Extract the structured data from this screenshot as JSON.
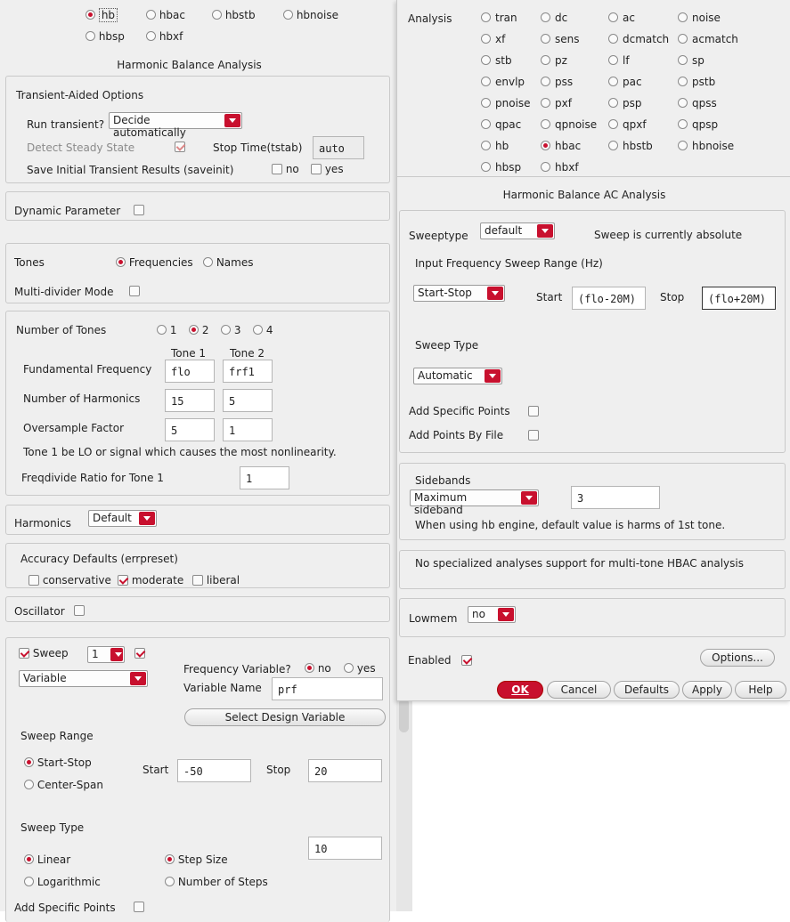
{
  "left": {
    "analysis_row1": [
      {
        "label": "hb",
        "selected": true
      },
      {
        "label": "hbac",
        "selected": false
      },
      {
        "label": "hbstb",
        "selected": false
      },
      {
        "label": "hbnoise",
        "selected": false
      }
    ],
    "analysis_row2": [
      {
        "label": "hbsp",
        "selected": false
      },
      {
        "label": "hbxf",
        "selected": false
      }
    ],
    "section_title": "Harmonic Balance Analysis",
    "transient": {
      "title": "Transient-Aided Options",
      "run_label": "Run transient?",
      "run_value": "Decide automatically",
      "detect_label": "Detect Steady State",
      "stop_label": "Stop Time(tstab)",
      "stop_value": "auto",
      "save_label": "Save Initial Transient Results (saveinit)",
      "no_label": "no",
      "yes_label": "yes"
    },
    "dynamic_label": "Dynamic Parameter",
    "tones_label": "Tones",
    "frequencies_label": "Frequencies",
    "names_label": "Names",
    "multidivider_label": "Multi-divider Mode",
    "num_tones_label": "Number of Tones",
    "num_tones_options": [
      "1",
      "2",
      "3",
      "4"
    ],
    "tone1_header": "Tone 1",
    "tone2_header": "Tone 2",
    "fund_label": "Fundamental Frequency",
    "fund_values": [
      "flo",
      "frf1"
    ],
    "harm_label": "Number of Harmonics",
    "harm_values": [
      "15",
      "5"
    ],
    "over_label": "Oversample Factor",
    "over_values": [
      "5",
      "1"
    ],
    "tone_note": "Tone 1 be LO or signal which causes the most nonlinearity.",
    "freqdivide_label": "Freqdivide Ratio for Tone 1",
    "freqdivide_value": "1",
    "harmonics_label": "Harmonics",
    "harmonics_value": "Default",
    "accuracy_label": "Accuracy Defaults (errpreset)",
    "conservative_label": "conservative",
    "moderate_label": "moderate",
    "liberal_label": "liberal",
    "oscillator_label": "Oscillator",
    "sweep": {
      "label": "Sweep",
      "count": "1",
      "variable_value": "Variable",
      "freq_var_label": "Frequency Variable?",
      "no_label": "no",
      "yes_label": "yes",
      "var_name_label": "Variable Name",
      "var_name_value": "prf",
      "select_btn": "Select Design Variable",
      "range_label": "Sweep Range",
      "start_stop": "Start-Stop",
      "center_span": "Center-Span",
      "start_label": "Start",
      "start_value": "-50",
      "stop_label": "Stop",
      "stop_value": "20",
      "type_label": "Sweep Type",
      "step_value": "10",
      "linear": "Linear",
      "log": "Logarithmic",
      "step_size": "Step Size",
      "num_steps": "Number of Steps",
      "add_points": "Add Specific Points"
    }
  },
  "right": {
    "analysis_label": "Analysis",
    "analyses": [
      [
        "tran",
        "dc",
        "ac",
        "noise"
      ],
      [
        "xf",
        "sens",
        "dcmatch",
        "acmatch"
      ],
      [
        "stb",
        "pz",
        "lf",
        "sp"
      ],
      [
        "envlp",
        "pss",
        "pac",
        "pstb"
      ],
      [
        "pnoise",
        "pxf",
        "psp",
        "qpss"
      ],
      [
        "qpac",
        "qpnoise",
        "qpxf",
        "qpsp"
      ],
      [
        "hb",
        "hbac",
        "hbstb",
        "hbnoise"
      ],
      [
        "hbsp",
        "hbxf"
      ]
    ],
    "selected_analysis": "hbac",
    "section_title": "Harmonic Balance AC Analysis",
    "sweeptype_label": "Sweeptype",
    "sweeptype_value": "default",
    "sweep_status": "Sweep is currently absolute",
    "input_range_label": "Input Frequency Sweep Range (Hz)",
    "range_mode": "Start-Stop",
    "start_label": "Start",
    "start_value": "(flo-20M)",
    "stop_label": "Stop",
    "stop_value": "(flo+20M)",
    "sweep_type_label": "Sweep Type",
    "sweep_type_value": "Automatic",
    "add_points_label": "Add Specific Points",
    "add_file_label": "Add Points By File",
    "sidebands_label": "Sidebands",
    "sidebands_mode": "Maximum sideband",
    "sidebands_value": "3",
    "sidebands_note": "When using hb engine, default value is harms of 1st tone.",
    "multitone_note": "No specialized analyses support for multi-tone HBAC analysis",
    "lowmem_label": "Lowmem",
    "lowmem_value": "no",
    "enabled_label": "Enabled",
    "options_btn": "Options...",
    "ok_btn": "OK",
    "cancel_btn": "Cancel",
    "defaults_btn": "Defaults",
    "apply_btn": "Apply",
    "help_btn": "Help"
  }
}
